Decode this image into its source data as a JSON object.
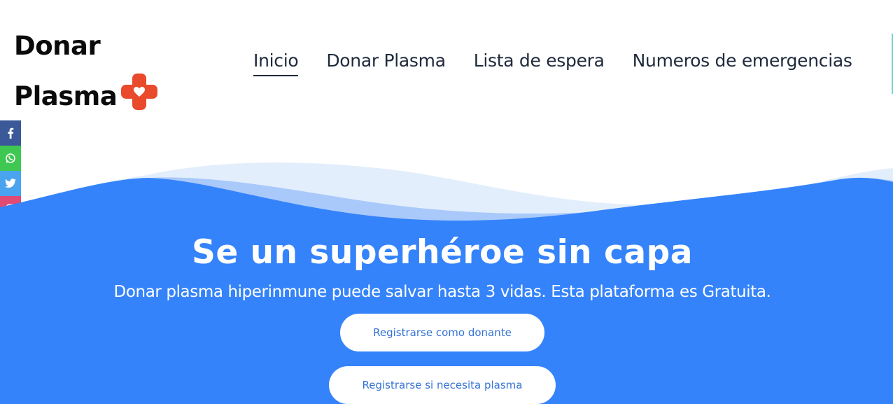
{
  "brand": {
    "line1": "Donar",
    "line2": "Plasma",
    "accent_color": "#e84a2b"
  },
  "nav": {
    "items": [
      {
        "label": "Inicio",
        "active": true
      },
      {
        "label": "Donar Plasma",
        "active": false
      },
      {
        "label": "Lista de espera",
        "active": false
      },
      {
        "label": "Numeros de emergencias",
        "active": false
      }
    ]
  },
  "social": [
    {
      "icon": "facebook-icon",
      "glyph": "f",
      "color": "#3b5998"
    },
    {
      "icon": "whatsapp-icon",
      "glyph": "✆",
      "color": "#3fc851"
    },
    {
      "icon": "twitter-icon",
      "glyph": "🐦",
      "color": "#4aa3ee"
    },
    {
      "icon": "instagram-icon",
      "glyph": "◎",
      "color": "#e04a73"
    }
  ],
  "hero": {
    "title": "Se un superhéroe sin capa",
    "subtitle": "Donar plasma hiperinmune puede salvar hasta 3 vidas. Esta plataforma es Gratuita.",
    "background_color": "#3483fa",
    "buttons": {
      "donor": "Registrarse como donante",
      "need": "Registrarse si necesita plasma"
    }
  }
}
